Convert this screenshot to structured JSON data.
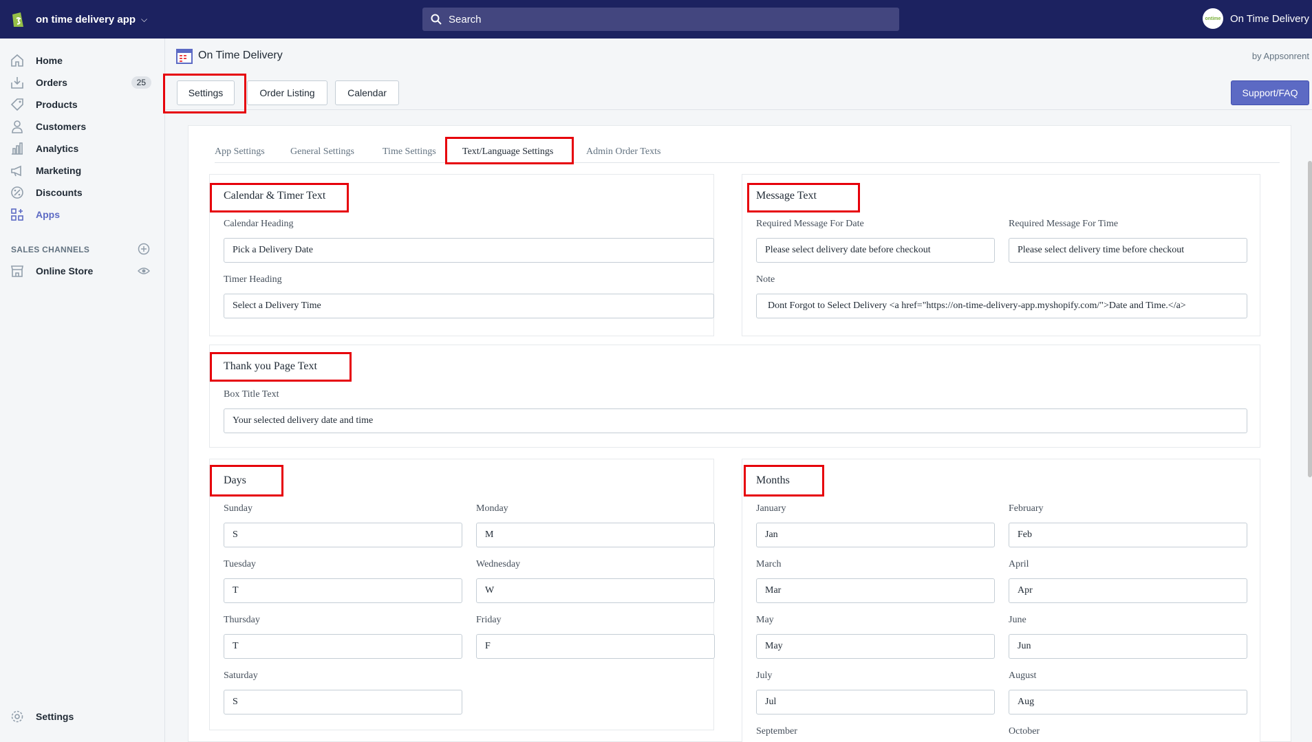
{
  "topbar": {
    "store_name": "on time delivery app",
    "search_placeholder": "Search",
    "account_name": "On Time Delivery",
    "avatar_text": "ontime"
  },
  "sidebar": {
    "items": [
      {
        "label": "Home",
        "icon": "home-icon"
      },
      {
        "label": "Orders",
        "icon": "orders-icon",
        "badge": "25"
      },
      {
        "label": "Products",
        "icon": "tag-icon"
      },
      {
        "label": "Customers",
        "icon": "person-icon"
      },
      {
        "label": "Analytics",
        "icon": "bar-chart-icon"
      },
      {
        "label": "Marketing",
        "icon": "megaphone-icon"
      },
      {
        "label": "Discounts",
        "icon": "discount-icon"
      },
      {
        "label": "Apps",
        "icon": "apps-icon",
        "active": true
      }
    ],
    "sales_channels_heading": "SALES CHANNELS",
    "online_store": "Online Store",
    "settings": "Settings"
  },
  "app": {
    "title": "On Time Delivery",
    "by": "by Appsonrent",
    "tabs": [
      "Settings",
      "Order Listing",
      "Calendar"
    ],
    "support_label": "Support/FAQ"
  },
  "settings_tabs": [
    "App Settings",
    "General Settings",
    "Time Settings",
    "Text/Language Settings",
    "Admin Order Texts"
  ],
  "calendar_timer": {
    "title": "Calendar & Timer Text",
    "calendar_heading_label": "Calendar Heading",
    "calendar_heading_value": "Pick a Delivery Date",
    "timer_heading_label": "Timer Heading",
    "timer_heading_value": "Select a Delivery Time"
  },
  "message_text": {
    "title": "Message Text",
    "date_label": "Required Message For Date",
    "date_value": "Please select delivery date before checkout",
    "time_label": "Required Message For Time",
    "time_value": "Please select delivery time before checkout",
    "note_label": "Note",
    "note_value": "Dont Forgot to Select Delivery <a href=\"https://on-time-delivery-app.myshopify.com/\">Date and Time.</a>"
  },
  "thank_you": {
    "title": "Thank you Page Text",
    "box_title_label": "Box Title Text",
    "box_title_value": "Your selected delivery date and time"
  },
  "days": {
    "title": "Days",
    "sunday_label": "Sunday",
    "sunday_value": "S",
    "monday_label": "Monday",
    "monday_value": "M",
    "tuesday_label": "Tuesday",
    "tuesday_value": "T",
    "wednesday_label": "Wednesday",
    "wednesday_value": "W",
    "thursday_label": "Thursday",
    "thursday_value": "T",
    "friday_label": "Friday",
    "friday_value": "F",
    "saturday_label": "Saturday",
    "saturday_value": "S"
  },
  "months": {
    "title": "Months",
    "january_label": "January",
    "january_value": "Jan",
    "february_label": "February",
    "february_value": "Feb",
    "march_label": "March",
    "march_value": "Mar",
    "april_label": "April",
    "april_value": "Apr",
    "may_label": "May",
    "may_value": "May",
    "june_label": "June",
    "june_value": "Jun",
    "july_label": "July",
    "july_value": "Jul",
    "august_label": "August",
    "august_value": "Aug",
    "september_label": "September",
    "october_label": "October"
  },
  "colors": {
    "topbar": "#1c2260",
    "accent": "#5c6ac4",
    "highlight": "#e6000a"
  }
}
